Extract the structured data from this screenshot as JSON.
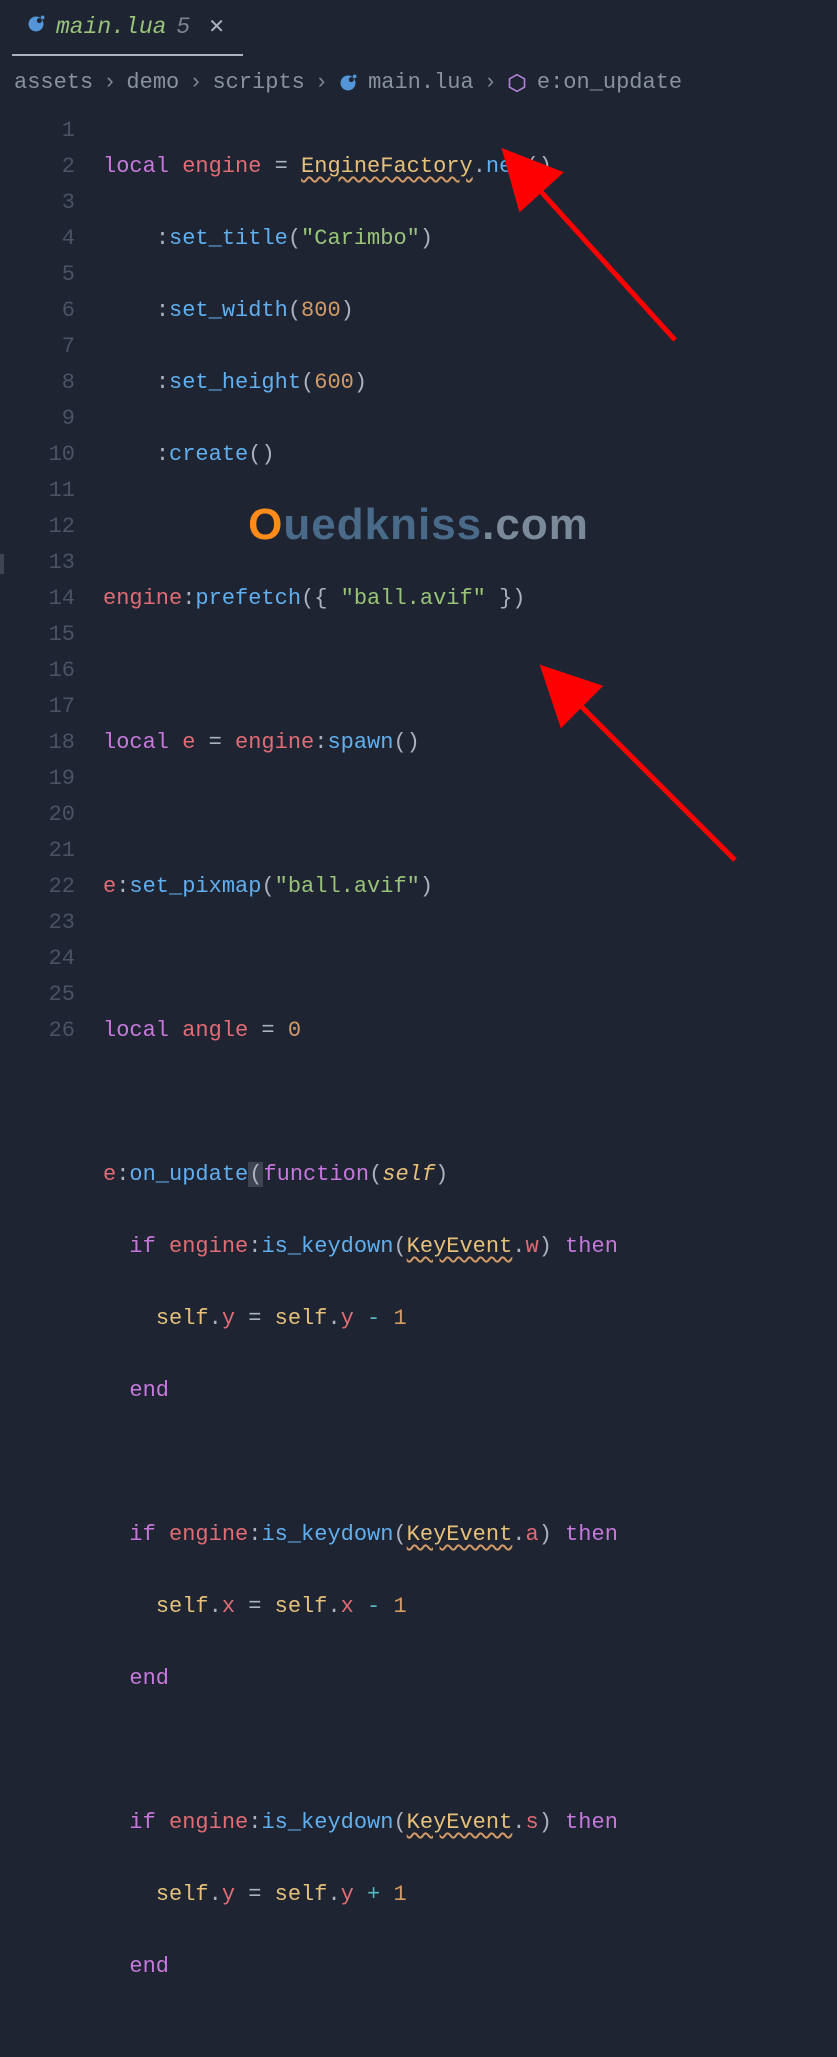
{
  "tab": {
    "name": "main.lua",
    "badge": "5"
  },
  "breadcrumb": {
    "parts": [
      "assets",
      "demo",
      "scripts",
      "main.lua",
      "e:on_update"
    ]
  },
  "code": {
    "lines": [
      1,
      2,
      3,
      4,
      5,
      6,
      7,
      8,
      9,
      10,
      11,
      12,
      13,
      14,
      15,
      16,
      17,
      18,
      19,
      20,
      21,
      22,
      23,
      24,
      25,
      26
    ]
  },
  "watermark": {
    "o": "O",
    "mid": "uedkniss",
    "com": ".com"
  },
  "t": {
    "local": "local",
    "engine": "engine",
    "eq": " = ",
    "EngineFactory": "EngineFactory",
    "dot": ".",
    "new": "new",
    "op": "(",
    "cp": ")",
    "colon": ":",
    "set_title": "set_title",
    "carimbo": "\"Carimbo\"",
    "set_width": "set_width",
    "n800": "800",
    "set_height": "set_height",
    "n600": "600",
    "create": "create",
    "prefetch": "prefetch",
    "ocb": "({ ",
    "ballavif": "\"ball.avif\"",
    "ccb": " })",
    "e": "e",
    "spawn": "spawn",
    "set_pixmap": "set_pixmap",
    "angle": "angle",
    "zero": "0",
    "on_update": "on_update",
    "function": "function",
    "self": "self",
    "if": "if",
    "is_keydown": "is_keydown",
    "KeyEvent": "KeyEvent",
    "w": "w",
    "a": "a",
    "s": "s",
    "then": "then",
    "y": "y",
    "x": "x",
    "minus": " - ",
    "plus": " + ",
    "one": "1",
    "end": "end"
  }
}
